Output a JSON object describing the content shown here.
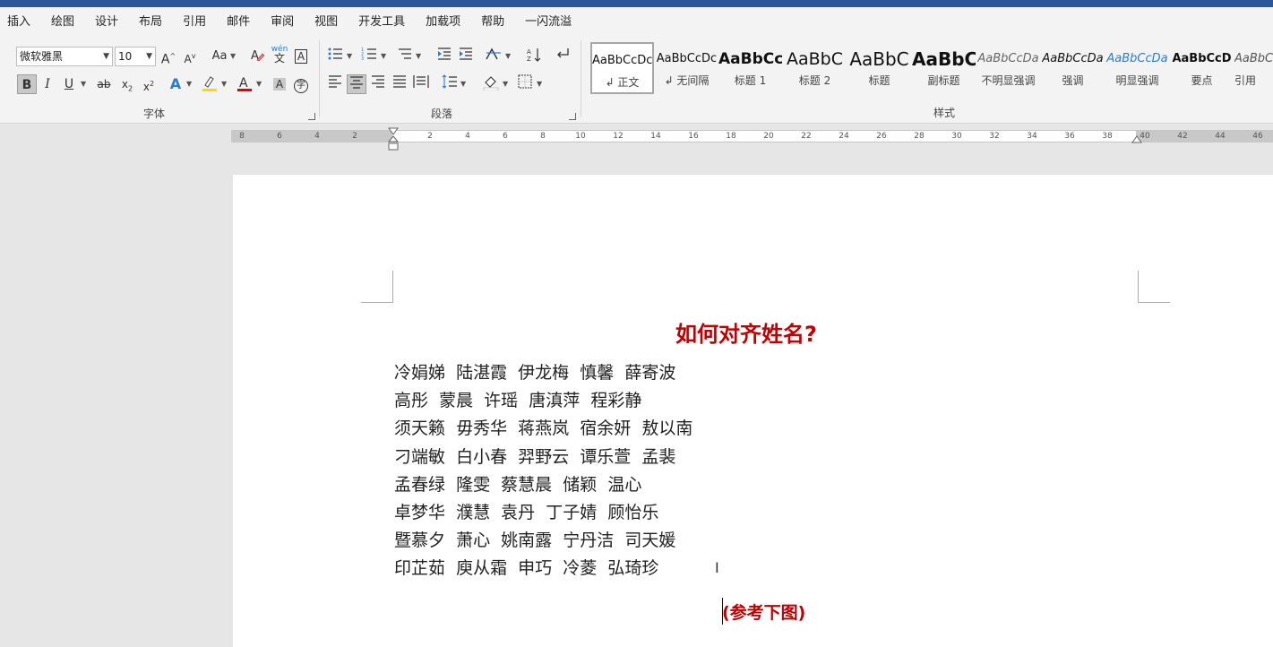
{
  "ribbon_tabs": [
    "插入",
    "绘图",
    "设计",
    "布局",
    "引用",
    "邮件",
    "审阅",
    "视图",
    "开发工具",
    "加载项",
    "帮助",
    "一闪流溢"
  ],
  "font_group": {
    "label": "字体",
    "font_name": "微软雅黑",
    "font_size": "10"
  },
  "paragraph_group": {
    "label": "段落"
  },
  "styles_group": {
    "label": "样式",
    "items": [
      {
        "sample": "AaBbCcDc",
        "name": "↲ 正文",
        "active": true
      },
      {
        "sample": "AaBbCcDc",
        "name": "↲ 无间隔"
      },
      {
        "sample": "AaBbCc",
        "name": "标题 1"
      },
      {
        "sample": "AaBbC",
        "name": "标题 2"
      },
      {
        "sample": "AaBbC",
        "name": "标题"
      },
      {
        "sample": "AaBbC",
        "name": "副标题"
      },
      {
        "sample": "AaBbCcDa",
        "name": "不明显强调"
      },
      {
        "sample": "AaBbCcDa",
        "name": "强调"
      },
      {
        "sample": "AaBbCcDa",
        "name": "明显强调"
      },
      {
        "sample": "AaBbCcD",
        "name": "要点"
      },
      {
        "sample": "AaBbCc",
        "name": "引用"
      }
    ]
  },
  "ruler": {
    "labels": [
      "8",
      "6",
      "4",
      "2",
      "2",
      "4",
      "6",
      "8",
      "10",
      "12",
      "14",
      "16",
      "18",
      "20",
      "22",
      "24",
      "26",
      "28",
      "30",
      "32",
      "34",
      "36",
      "38",
      "40",
      "42",
      "44",
      "46"
    ]
  },
  "document": {
    "title": "如何对齐姓名?",
    "name_lines": [
      "冷娟娣  陆湛霞  伊龙梅  慎馨  薛寄波",
      "高彤  蒙晨  许瑶  唐滇萍  程彩静",
      "须天籁  毋秀华  蒋燕岚  宿余妍  敖以南",
      "刁端敏  白小春  羿野云  谭乐萱  孟裴",
      "孟春绿  隆雯  蔡慧晨  储颖  温心",
      "卓梦华  濮慧  袁丹  丁子婧  顾怡乐",
      "暨慕夕  萧心  姚南露  宁丹洁  司天媛",
      "印芷茹  庾从霜  申巧  冷菱  弘琦珍"
    ],
    "note": "(参考下图)"
  },
  "colors": {
    "title_bar": "#2b579a",
    "accent_red": "#c00000",
    "highlight_yellow": "#ffd800",
    "font_color_red": "#e00000"
  }
}
